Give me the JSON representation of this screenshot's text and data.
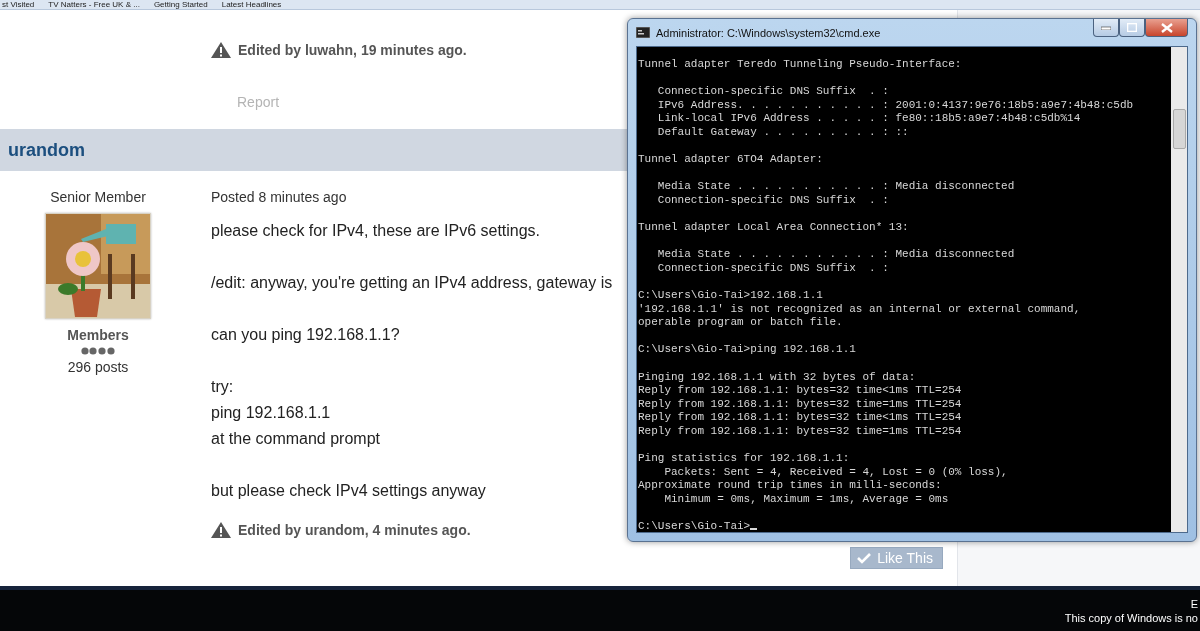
{
  "bookmarks": [
    "st Visited",
    "TV Natters - Free UK & ...",
    "Getting Started",
    "Latest Headlines"
  ],
  "previous_post": {
    "edit_note": "Edited by luwahn, 19 minutes ago.",
    "report": "Report"
  },
  "post": {
    "author": "urandom",
    "author_title": "Senior Member",
    "group": "Members",
    "post_count": "296 posts",
    "posted": "Posted 8 minutes ago",
    "paragraphs": [
      [
        "please check for IPv4, these are IPv6 settings."
      ],
      [
        "/edit: anyway, you're getting an IPv4 address, gateway is"
      ],
      [
        "can you ping 192.168.1.1?"
      ],
      [
        "try:",
        "ping 192.168.1.1",
        "at the command prompt"
      ],
      [
        "but please check IPv4 settings anyway"
      ]
    ],
    "edit_note": "Edited by urandom, 4 minutes ago.",
    "like_button": "Like This"
  },
  "console": {
    "title": "Administrator: C:\\Windows\\system32\\cmd.exe",
    "blocks": [
      [
        "Tunnel adapter Teredo Tunneling Pseudo-Interface:"
      ],
      [
        "   Connection-specific DNS Suffix  . :",
        "   IPv6 Address. . . . . . . . . . . : 2001:0:4137:9e76:18b5:a9e7:4b48:c5db",
        "   Link-local IPv6 Address . . . . . : fe80::18b5:a9e7:4b48:c5db%14",
        "   Default Gateway . . . . . . . . . : ::"
      ],
      [
        "Tunnel adapter 6TO4 Adapter:"
      ],
      [
        "   Media State . . . . . . . . . . . : Media disconnected",
        "   Connection-specific DNS Suffix  . :"
      ],
      [
        "Tunnel adapter Local Area Connection* 13:"
      ],
      [
        "   Media State . . . . . . . . . . . : Media disconnected",
        "   Connection-specific DNS Suffix  . :"
      ],
      [
        "C:\\Users\\Gio-Tai>192.168.1.1",
        "'192.168.1.1' is not recognized as an internal or external command,",
        "operable program or batch file."
      ],
      [
        "C:\\Users\\Gio-Tai>ping 192.168.1.1"
      ],
      [
        "Pinging 192.168.1.1 with 32 bytes of data:",
        "Reply from 192.168.1.1: bytes=32 time<1ms TTL=254",
        "Reply from 192.168.1.1: bytes=32 time=1ms TTL=254",
        "Reply from 192.168.1.1: bytes=32 time<1ms TTL=254",
        "Reply from 192.168.1.1: bytes=32 time=1ms TTL=254"
      ],
      [
        "Ping statistics for 192.168.1.1:",
        "    Packets: Sent = 4, Received = 4, Lost = 0 (0% loss),",
        "Approximate round trip times in milli-seconds:",
        "    Minimum = 0ms, Maximum = 1ms, Average = 0ms"
      ]
    ],
    "prompt": "C:\\Users\\Gio-Tai>"
  },
  "taskbar": {
    "notice_lines": [
      "E",
      "This copy of Windows is no"
    ]
  }
}
